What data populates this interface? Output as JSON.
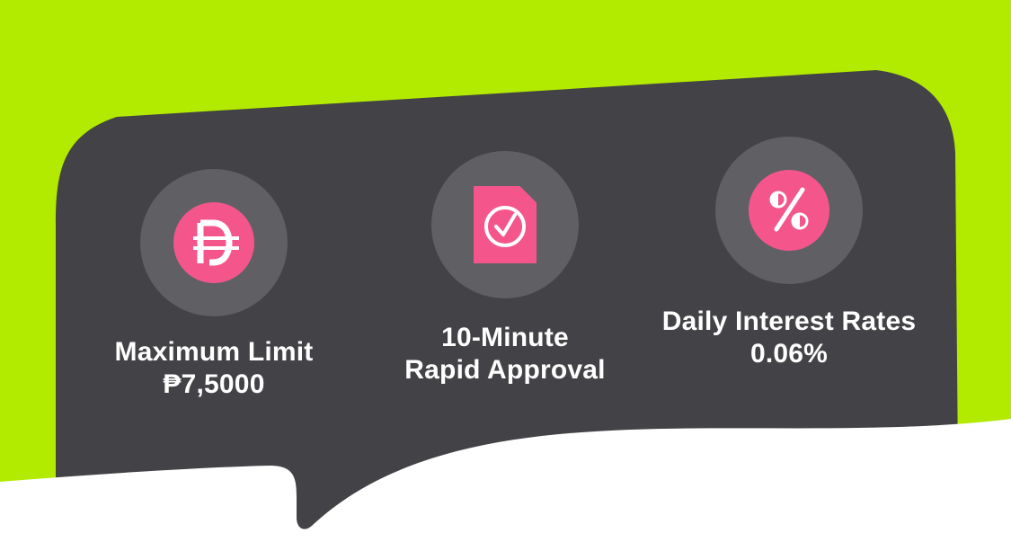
{
  "colors": {
    "background_top": "#b2ea00",
    "panel": "#434246",
    "badge": "#606064",
    "accent": "#f4568b",
    "text": "#ffffff",
    "bottom": "#ffffff"
  },
  "features": [
    {
      "icon": "peso-icon",
      "line1": "Maximum Limit",
      "line2": "₱7,5000"
    },
    {
      "icon": "approval-document-icon",
      "line1": "10-Minute",
      "line2": "Rapid Approval"
    },
    {
      "icon": "percent-icon",
      "line1": "Daily Interest Rates",
      "line2": "0.06%"
    }
  ]
}
